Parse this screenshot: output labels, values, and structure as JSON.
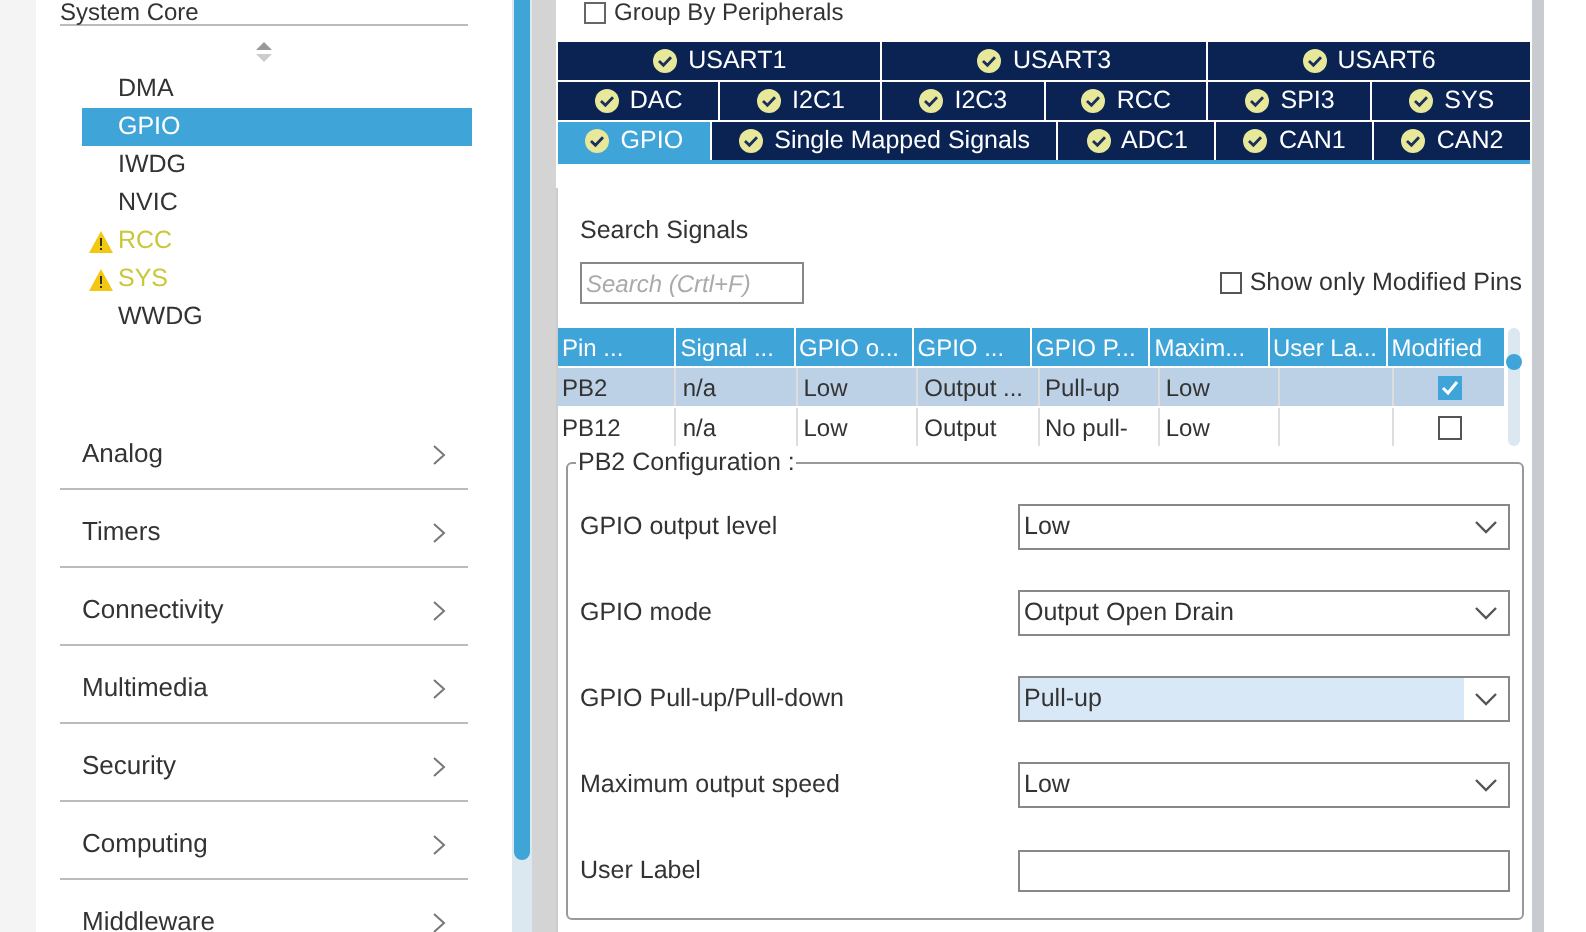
{
  "sidebar": {
    "category": "System Core",
    "items": [
      {
        "label": "DMA",
        "selected": false,
        "warning": false
      },
      {
        "label": "GPIO",
        "selected": true,
        "warning": false
      },
      {
        "label": "IWDG",
        "selected": false,
        "warning": false
      },
      {
        "label": "NVIC",
        "selected": false,
        "warning": false
      },
      {
        "label": "RCC",
        "selected": false,
        "warning": true
      },
      {
        "label": "SYS",
        "selected": false,
        "warning": true
      },
      {
        "label": "WWDG",
        "selected": false,
        "warning": false
      }
    ],
    "categories": [
      "Analog",
      "Timers",
      "Connectivity",
      "Multimedia",
      "Security",
      "Computing",
      "Middleware"
    ]
  },
  "group_by": {
    "label": "Group By Peripherals",
    "checked": false
  },
  "tab_rows": [
    [
      {
        "label": "USART1",
        "selected": false
      },
      {
        "label": "USART3",
        "selected": false
      },
      {
        "label": "USART6",
        "selected": false
      }
    ],
    [
      {
        "label": "DAC",
        "selected": false
      },
      {
        "label": "I2C1",
        "selected": false
      },
      {
        "label": "I2C3",
        "selected": false
      },
      {
        "label": "RCC",
        "selected": false
      },
      {
        "label": "SPI3",
        "selected": false
      },
      {
        "label": "SYS",
        "selected": false
      }
    ],
    [
      {
        "label": "GPIO",
        "selected": true
      },
      {
        "label": "Single Mapped Signals",
        "selected": false
      },
      {
        "label": "ADC1",
        "selected": false
      },
      {
        "label": "CAN1",
        "selected": false
      },
      {
        "label": "CAN2",
        "selected": false
      }
    ]
  ],
  "search": {
    "label": "Search Signals",
    "placeholder": "Search (Crtl+F)"
  },
  "modified_only": {
    "label": "Show only Modified Pins",
    "checked": false
  },
  "table": {
    "columns": [
      "Pin ...",
      "Signal ...",
      "GPIO o...",
      "GPIO ...",
      "GPIO P...",
      "Maxim...",
      "User La...",
      "Modified"
    ],
    "rows": [
      {
        "cells": [
          "PB2",
          "n/a",
          "Low",
          "Output ...",
          "Pull-up",
          "Low"
        ],
        "modified": true,
        "selected": true
      },
      {
        "cells": [
          "PB12",
          "n/a",
          "Low",
          "Output",
          "No pull-",
          "Low"
        ],
        "modified": false,
        "selected": false
      }
    ]
  },
  "config": {
    "title": "PB2 Configuration :",
    "fields": [
      {
        "label": "GPIO output level",
        "kind": "select",
        "value": "Low",
        "highlighted": false
      },
      {
        "label": "GPIO mode",
        "kind": "select",
        "value": "Output Open Drain",
        "highlighted": false
      },
      {
        "label": "GPIO Pull-up/Pull-down",
        "kind": "select",
        "value": "Pull-up",
        "highlighted": true
      },
      {
        "label": "Maximum output speed",
        "kind": "select",
        "value": "Low",
        "highlighted": false
      },
      {
        "label": "User Label",
        "kind": "text",
        "highlighted": false
      }
    ]
  }
}
